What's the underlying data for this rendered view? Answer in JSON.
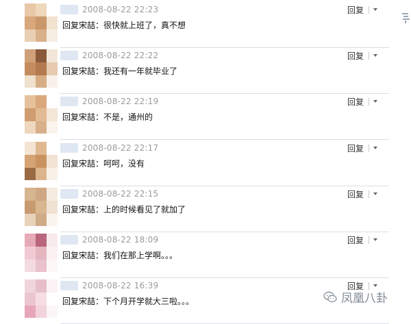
{
  "reply_button_label": "回复",
  "watermark_text": "凤凰八卦",
  "comments": [
    {
      "timestamp": "2008-08-22 22:23",
      "text": "回复宋喆：很快就上班了，真不想",
      "avatar_colors": [
        "#e8c8a8",
        "#f0d8bc",
        "#ffffff",
        "#d9a77c",
        "#c9976a",
        "#f2e2d0",
        "#e9cfb3",
        "#d8b08a",
        "#f7eee4"
      ]
    },
    {
      "timestamp": "2008-08-22 22:22",
      "text": "回复宋喆：我还有一年就毕业了",
      "avatar_colors": [
        "#d0a078",
        "#8a5a3a",
        "#f3e6d8",
        "#c48c5e",
        "#b27a4e",
        "#e6cbb0",
        "#f0e0ce",
        "#d6ad85",
        "#f8f1ea"
      ]
    },
    {
      "timestamp": "2008-08-22 22:19",
      "text": "回复宋喆：不是，通州的",
      "avatar_colors": [
        "#e6c29c",
        "#d9a87d",
        "#ffffff",
        "#cf9b6f",
        "#e2bb94",
        "#f4e6d6",
        "#efd7bd",
        "#d7b089",
        "#fbf4ec"
      ]
    },
    {
      "timestamp": "2008-08-22 22:17",
      "text": "回复宋喆：呵呵，没有",
      "avatar_colors": [
        "#f3e4d3",
        "#e0b991",
        "#ffffff",
        "#d6a374",
        "#c9925f",
        "#f2e3d4",
        "#9a6a44",
        "#dcb58d",
        "#f9f1e8"
      ]
    },
    {
      "timestamp": "2008-08-22 22:15",
      "text": "回复宋喆：上的时候看见了就加了",
      "avatar_colors": [
        "#d7b591",
        "#cfa783",
        "#f5ebe0",
        "#c79a70",
        "#d9b690",
        "#f0e2d3",
        "#e8d2ba",
        "#cfab88",
        "#faf4ee"
      ]
    },
    {
      "timestamp": "2008-08-22 18:09",
      "text": "回复宋喆：我们在那上学啊。。。",
      "avatar_colors": [
        "#e6a9b6",
        "#b9667c",
        "#f7e9ec",
        "#f2cad3",
        "#e3b6c0",
        "#fbf1f3",
        "#f4dbe1",
        "#e9c2cb",
        "#fdf7f8"
      ]
    },
    {
      "timestamp": "2008-08-22 16:39",
      "text": "回复宋喆：下个月开学就大三啦。。。",
      "avatar_colors": [
        "#f0d5dc",
        "#e6bfca",
        "#fbf3f5",
        "#ecc6cf",
        "#f5dde3",
        "#ffffff",
        "#e7a7b8",
        "#f3d3db",
        "#fcf5f7"
      ]
    }
  ],
  "edge_fragment_color": "#9aa7b6"
}
